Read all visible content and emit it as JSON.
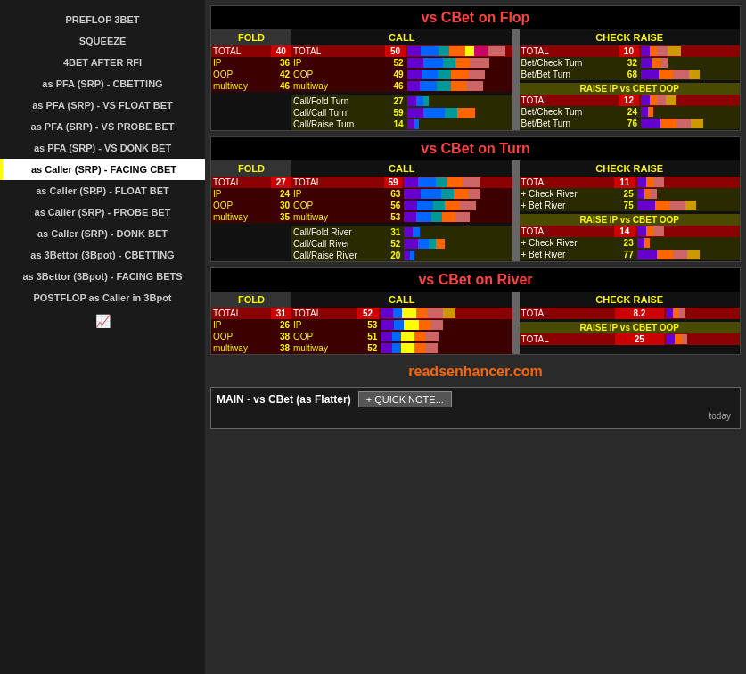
{
  "sidebar": {
    "items": [
      {
        "label": "PREFLOP 3BET",
        "active": false
      },
      {
        "label": "SQUEEZE",
        "active": false
      },
      {
        "label": "4BET AFTER RFI",
        "active": false
      },
      {
        "label": "as PFA (SRP) - CBETTING",
        "active": false
      },
      {
        "label": "as PFA (SRP) - VS FLOAT BET",
        "active": false
      },
      {
        "label": "as PFA (SRP) - VS PROBE BET",
        "active": false
      },
      {
        "label": "as PFA (SRP) - VS DONK BET",
        "active": false
      },
      {
        "label": "as Caller (SRP) - FACING CBET",
        "active": true
      },
      {
        "label": "as Caller (SRP) - FLOAT BET",
        "active": false
      },
      {
        "label": "as Caller (SRP) - PROBE BET",
        "active": false
      },
      {
        "label": "as Caller (SRP) - DONK BET",
        "active": false
      },
      {
        "label": "as 3Bettor (3Bpot) - CBETTING",
        "active": false
      },
      {
        "label": "as 3Bettor (3Bpot) - FACING BETS",
        "active": false
      },
      {
        "label": "POSTFLOP as Caller in 3Bpot",
        "active": false
      }
    ],
    "icon": "📈"
  },
  "sections": {
    "flop": {
      "title": "vs CBet on Flop",
      "fold": {
        "total": 40,
        "ip": 36,
        "oop": 42,
        "multiway": 46
      },
      "call": {
        "total": 50,
        "ip": 52,
        "oop": 49,
        "multiway": 46,
        "sub_rows": [
          {
            "label": "Call/Fold Turn",
            "val": 27
          },
          {
            "label": "Call/Call Turn",
            "val": 59
          },
          {
            "label": "Call/Raise Turn",
            "val": 14
          }
        ]
      },
      "check_raise": {
        "total": 10,
        "sub_rows": [
          {
            "label": "Bet/Check Turn",
            "val": 32
          },
          {
            "label": "Bet/Bet Turn",
            "val": 68
          }
        ],
        "raise_ip": {
          "header": "RAISE IP vs CBET OOP",
          "total": 12,
          "sub_rows": [
            {
              "label": "Bet/Check Turn",
              "val": 24
            },
            {
              "label": "Bet/Bet Turn",
              "val": 76
            }
          ]
        }
      }
    },
    "turn": {
      "title": "vs CBet on Turn",
      "fold": {
        "total": 27,
        "ip": 24,
        "oop": 30,
        "multiway": 35
      },
      "call": {
        "total": 59,
        "ip": 63,
        "oop": 56,
        "multiway": 53,
        "sub_rows": [
          {
            "label": "Call/Fold River",
            "val": 31
          },
          {
            "label": "Call/Call River",
            "val": 52
          },
          {
            "label": "Call/Raise River",
            "val": 20
          }
        ]
      },
      "check_raise": {
        "total": 11,
        "sub_rows": [
          {
            "label": "+ Check River",
            "val": 25
          },
          {
            "label": "+ Bet River",
            "val": 75
          }
        ],
        "raise_ip": {
          "header": "RAISE IP vs CBET OOP",
          "total": 14,
          "sub_rows": [
            {
              "label": "+ Check River",
              "val": 23
            },
            {
              "label": "+ Bet River",
              "val": 77
            }
          ]
        }
      }
    },
    "river": {
      "title": "vs CBet on River",
      "fold": {
        "total": 31,
        "ip": 26,
        "oop": 38,
        "multiway": 38
      },
      "call": {
        "total": 52,
        "ip": 53,
        "oop": 51,
        "multiway": 52,
        "sub_rows": []
      },
      "check_raise": {
        "total": "8.2",
        "sub_rows": [],
        "raise_ip": {
          "header": "RAISE IP vs CBET OOP",
          "total": 25,
          "sub_rows": []
        }
      }
    }
  },
  "footer": {
    "website": "readsenhancer.com",
    "note_title": "MAIN - vs CBet (as Flatter)",
    "quick_note_label": "+ QUICK NOTE...",
    "date": "today"
  }
}
